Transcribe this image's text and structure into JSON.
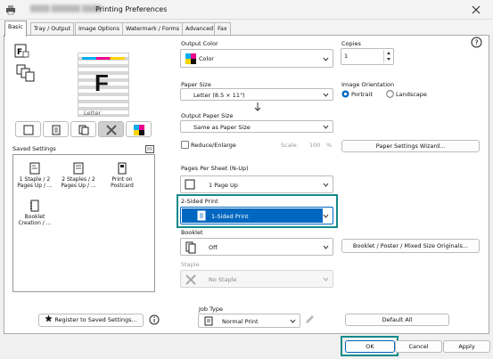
{
  "window": {
    "title": "Printing Preferences",
    "blurred_prefix": "████ ██████ ████"
  },
  "tabs": [
    {
      "label": "Basic",
      "active": true
    },
    {
      "label": "Tray / Output"
    },
    {
      "label": "Image Options"
    },
    {
      "label": "Watermark / Forms"
    },
    {
      "label": "Advanced"
    },
    {
      "label": "Fax"
    }
  ],
  "preview": {
    "paper_letter": "F",
    "paper_caption": "Letter"
  },
  "saved_settings": {
    "label": "Saved Settings",
    "items": [
      {
        "line1": "1 Staple / 2",
        "line2": "Pages Up / ..."
      },
      {
        "line1": "2 Staples / 2",
        "line2": "Pages Up / ..."
      },
      {
        "line1": "Print on",
        "line2": "Postcard"
      },
      {
        "line1": "Booklet",
        "line2": "Creation / ..."
      }
    ]
  },
  "output_color": {
    "label": "Output Color",
    "value": "Color"
  },
  "copies": {
    "label": "Copies",
    "value": "1"
  },
  "paper_size": {
    "label": "Paper Size",
    "value": "Letter (8.5 × 11\")"
  },
  "output_paper_size": {
    "label": "Output Paper Size",
    "value": "Same as Paper Size"
  },
  "image_orientation": {
    "label": "Image Orientation",
    "portrait": "Portrait",
    "landscape": "Landscape"
  },
  "reduce_enlarge": {
    "label": "Reduce/Enlarge",
    "scale_label": "Scale:",
    "scale_value": "100",
    "unit": "%"
  },
  "paper_settings_wizard": "Paper Settings Wizard...",
  "pages_per_sheet": {
    "label": "Pages Per Sheet (N-Up)",
    "value": "1 Page Up"
  },
  "two_sided": {
    "label": "2-Sided Print",
    "value": "1-Sided Print"
  },
  "booklet": {
    "label": "Booklet",
    "value": "Off"
  },
  "booklet_button": "Booklet / Poster / Mixed Size Originals...",
  "staple": {
    "label": "Staple",
    "value": "No Staple"
  },
  "register_button": "Register to Saved Settings...",
  "job_type": {
    "label": "Job Type",
    "value": "Normal Print"
  },
  "default_all": "Default All",
  "footer": {
    "ok": "OK",
    "cancel": "Cancel",
    "apply": "Apply"
  },
  "help_glyph": "?",
  "colors": {
    "accent": "#0a66c2",
    "highlight_border": "#138a8a",
    "selection": "#0067c0"
  }
}
